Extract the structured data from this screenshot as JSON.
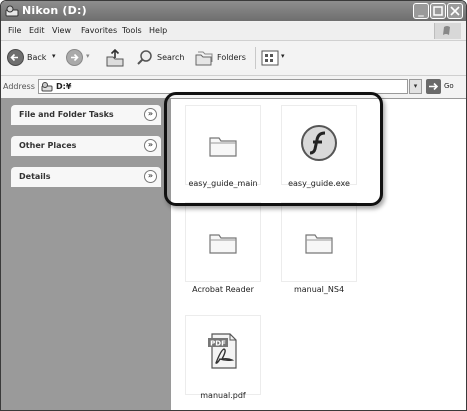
{
  "window": {
    "title": "Nikon (D:)"
  },
  "menu": [
    "File",
    "Edit",
    "View",
    "Favorites",
    "Tools",
    "Help"
  ],
  "toolbar": {
    "back_label": "Back",
    "search_label": "Search",
    "folders_label": "Folders"
  },
  "address": {
    "label": "Address",
    "value": "D:¥",
    "go_label": "Go"
  },
  "sidebar": {
    "panels": [
      "File and Folder Tasks",
      "Other Places",
      "Details"
    ],
    "chevron": "»"
  },
  "content": {
    "items": [
      {
        "name": "easy_guide_main",
        "icon": "folder-icon"
      },
      {
        "name": "easy_guide.exe",
        "icon": "flash-app-icon"
      },
      {
        "name": "Acrobat Reader",
        "icon": "folder-icon"
      },
      {
        "name": "manual_NS4",
        "icon": "folder-icon"
      },
      {
        "name": "manual.pdf",
        "icon": "pdf-file-icon"
      }
    ]
  }
}
